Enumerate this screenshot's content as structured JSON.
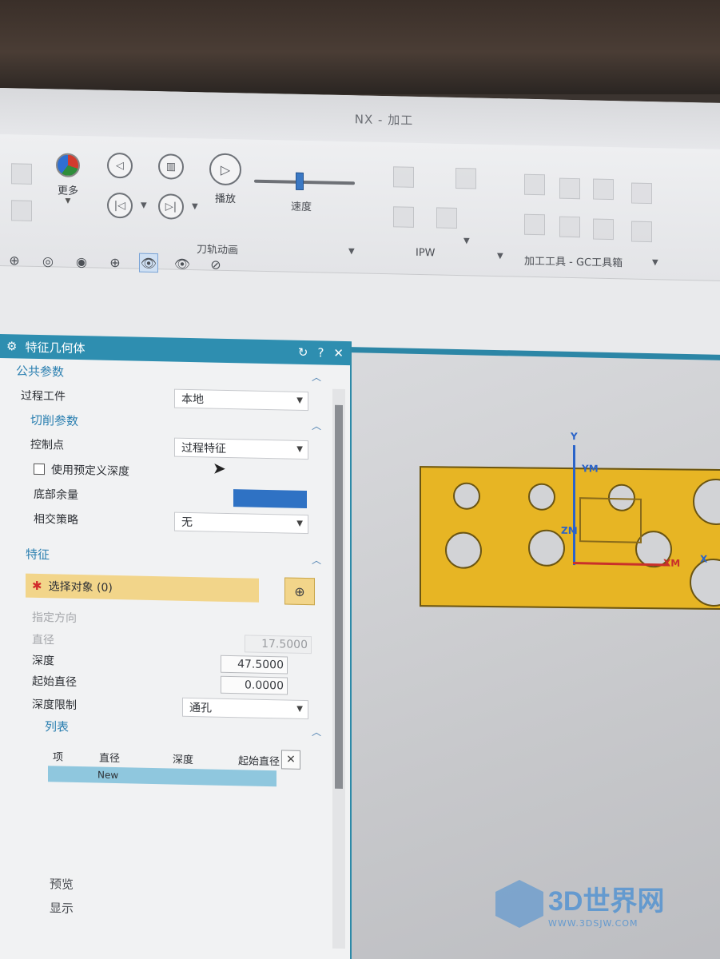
{
  "window": {
    "title": "NX - 加工"
  },
  "ribbon": {
    "more_label": "更多",
    "play_label": "播放",
    "speed_label": "速度",
    "speed_value": 0.45,
    "groups": {
      "tool_path_animation": "刀轨动画",
      "ipw": "IPW",
      "machining_tools": "加工工具 - GC工具箱"
    }
  },
  "dialog": {
    "title": "特征几何体",
    "sections": {
      "common_params": "公共参数",
      "cut_params": "切削参数",
      "feature": "特征",
      "list": "列表",
      "preview": "预览",
      "display": "显示"
    },
    "fields": {
      "process_workpiece": {
        "label": "过程工件",
        "value": "本地"
      },
      "control_point": {
        "label": "控制点",
        "value": "过程特征"
      },
      "use_predefined_depth": {
        "label": "使用预定义深度",
        "checked": false
      },
      "bottom_stock": {
        "label": "底部余量",
        "value": ""
      },
      "intersection_strategy": {
        "label": "相交策略",
        "value": "无"
      },
      "select_object": {
        "label": "选择对象 (0)"
      },
      "specify_direction": {
        "label": "指定方向"
      },
      "diameter": {
        "label": "直径",
        "value": "17.5000"
      },
      "depth": {
        "label": "深度",
        "value": "47.5000"
      },
      "start_diameter": {
        "label": "起始直径",
        "value": "0.0000"
      },
      "depth_limit": {
        "label": "深度限制",
        "value": "通孔"
      }
    },
    "list": {
      "columns": [
        "项",
        "直径",
        "深度",
        "起始直径"
      ],
      "rows": [
        {
          "item": "",
          "name": "New"
        }
      ]
    }
  },
  "graphics": {
    "axis_labels": {
      "y": "Y",
      "x": "X",
      "xm": "XM",
      "ym": "YM",
      "zm": "ZM"
    }
  },
  "watermark": {
    "brand": "3D世界网",
    "url": "WWW.3DSJW.COM"
  }
}
